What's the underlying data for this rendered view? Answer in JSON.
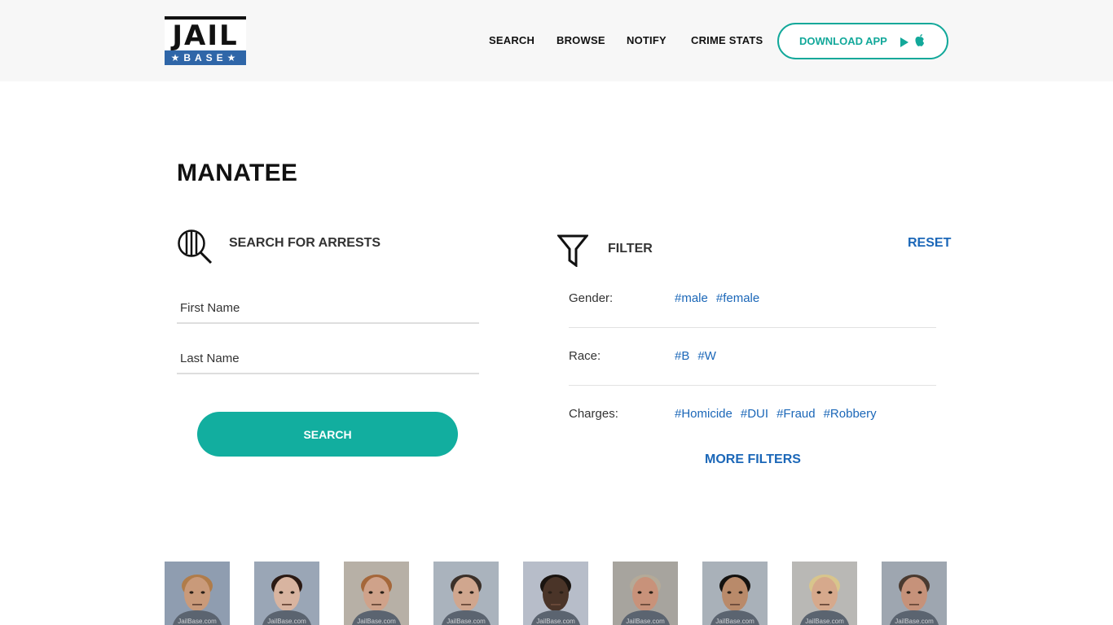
{
  "header": {
    "logo": {
      "top": "JAIL",
      "bottom": "★BASE★"
    },
    "nav": [
      "SEARCH",
      "BROWSE",
      "NOTIFY",
      "CRIME STATS"
    ],
    "download": {
      "label": "DOWNLOAD APP",
      "icons": [
        "play-store-icon",
        "apple-icon"
      ]
    }
  },
  "page": {
    "title": "MANATEE"
  },
  "search": {
    "heading": "SEARCH FOR ARRESTS",
    "first_name_placeholder": "First Name",
    "last_name_placeholder": "Last Name",
    "button": "SEARCH"
  },
  "filter": {
    "heading": "FILTER",
    "reset": "RESET",
    "rows": [
      {
        "label": "Gender:",
        "tags": [
          "#male",
          "#female"
        ]
      },
      {
        "label": "Race:",
        "tags": [
          "#B",
          "#W"
        ]
      },
      {
        "label": "Charges:",
        "tags": [
          "#Homicide",
          "#DUI",
          "#Fraud",
          "#Robbery"
        ]
      }
    ],
    "more": "MORE FILTERS"
  },
  "mugshots": {
    "watermark": "JailBase.com",
    "items": [
      {
        "bg": "#8f9db0",
        "skin": "#c99a7a",
        "hair": "#b07c4a"
      },
      {
        "bg": "#9aa6b6",
        "skin": "#d8b4a0",
        "hair": "#2b1a14"
      },
      {
        "bg": "#b7b0a6",
        "skin": "#cfa28a",
        "hair": "#a5673a"
      },
      {
        "bg": "#aab3bd",
        "skin": "#d0a68e",
        "hair": "#3b3029"
      },
      {
        "bg": "#b7bdc9",
        "skin": "#4a3428",
        "hair": "#1a1410"
      },
      {
        "bg": "#a7a49e",
        "skin": "#c8927a",
        "hair": "#b4aa98"
      },
      {
        "bg": "#a9b1b9",
        "skin": "#b98a6a",
        "hair": "#141210"
      },
      {
        "bg": "#b9b8b5",
        "skin": "#d6a98c",
        "hair": "#d8c58c"
      },
      {
        "bg": "#9ea6b0",
        "skin": "#c6927a",
        "hair": "#4a3a30"
      }
    ]
  }
}
